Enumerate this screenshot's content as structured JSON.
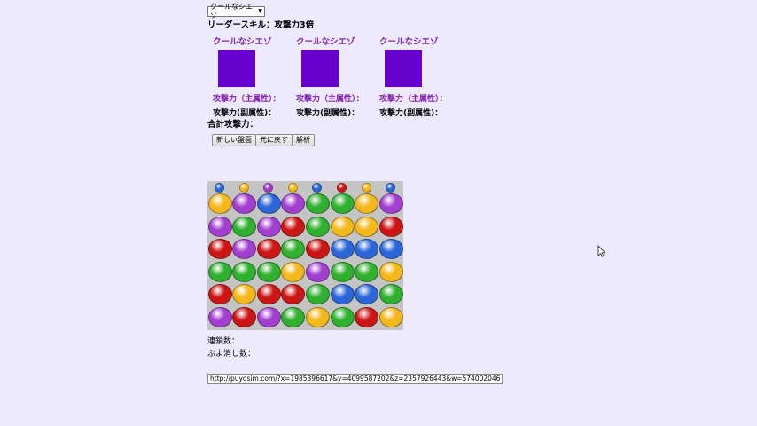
{
  "leader_select": {
    "value": "クールなシエゾ",
    "arrow": "▼"
  },
  "leader_skill": "リーダースキル：攻撃力3倍",
  "cards": [
    {
      "name": "クールなシエゾ",
      "attack_main": "攻撃力（主属性）：",
      "attack_sub": "攻撃力(副属性)："
    },
    {
      "name": "クールなシエゾ",
      "attack_main": "攻撃力（主属性）：",
      "attack_sub": "攻撃力(副属性)："
    },
    {
      "name": "クールなシエゾ",
      "attack_main": "攻撃力（主属性）：",
      "attack_sub": "攻撃力(副属性)："
    }
  ],
  "total_attack_label": "合計攻撃力：",
  "buttons": {
    "new_board": "新しい盤面",
    "undo": "元に戻す",
    "analyze": "解析"
  },
  "colors": {
    "background": "#eeeafd",
    "card_name": "#8020b0",
    "portrait": "#6600cc",
    "puyo": {
      "Y": "#f2b81c",
      "P": "#a33fd0",
      "B": "#2b66d8",
      "G": "#2fb02f",
      "R": "#cc1515"
    }
  },
  "board": {
    "next": [
      "B",
      "Y",
      "P",
      "Y",
      "B",
      "R",
      "Y",
      "B"
    ],
    "rows": [
      [
        "Y",
        "P",
        "B",
        "P",
        "G",
        "G",
        "Y",
        "P"
      ],
      [
        "P",
        "G",
        "P",
        "R",
        "G",
        "Y",
        "Y",
        "R"
      ],
      [
        "R",
        "P",
        "R",
        "G",
        "R",
        "B",
        "B",
        "B"
      ],
      [
        "G",
        "G",
        "G",
        "Y",
        "P",
        "G",
        "G",
        "Y"
      ],
      [
        "R",
        "Y",
        "R",
        "R",
        "G",
        "B",
        "B",
        "G"
      ],
      [
        "P",
        "R",
        "P",
        "G",
        "Y",
        "G",
        "R",
        "Y"
      ]
    ]
  },
  "chain_label": "連鎖数：",
  "puyo_clear_label": "ぷよ消し数：",
  "url_field": {
    "value": "http://puyosim.com/?x=1985396617&y=4099587202&z=2357926443&w=574002046"
  }
}
